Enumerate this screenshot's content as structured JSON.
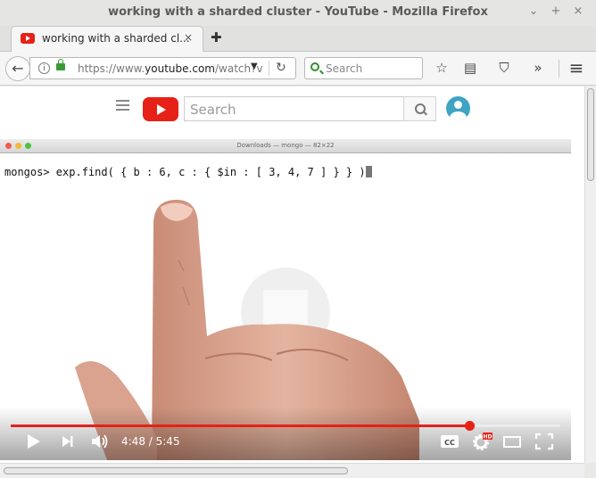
{
  "window": {
    "title": "working with a sharded cluster - YouTube - Mozilla Firefox",
    "controls": {
      "minimize": "⌄",
      "maximize": "+",
      "close": "×"
    }
  },
  "tab": {
    "title": "working with a sharded cl...",
    "favicon": "youtube-favicon",
    "close_label": "×",
    "new_tab_label": "✚"
  },
  "navbar": {
    "back_label": "←",
    "url_prefix": "https://www.",
    "url_domain": "youtube.com",
    "url_suffix": "/watch?v",
    "dropdown_label": "▼",
    "reload_label": "↻",
    "search_placeholder": "Search",
    "menu_glyphs": {
      "bookmark": "☆",
      "reading_list": "▤",
      "pocket": "⛉",
      "overflow": "»",
      "hamburger": "≡"
    }
  },
  "youtube": {
    "search_placeholder": "Search"
  },
  "video": {
    "terminal_title": "Downloads — mongo — 82×22",
    "command_text": "mongos> exp.find( { b : 6, c : { $in : [ 3, 4, 7 ] } } )",
    "current_time": "4:48",
    "duration": "5:45",
    "time_separator": " / ",
    "progress": 0.835,
    "colors": {
      "progress": "#e62117",
      "brand": "#e62117"
    }
  }
}
